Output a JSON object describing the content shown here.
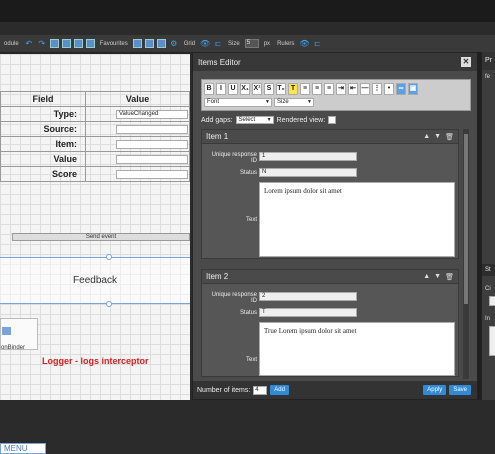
{
  "toolbar": {
    "module_label": "odule",
    "favourites_label": "Favourites",
    "grid_label": "Grid",
    "size_label": "Size",
    "size_value": "5",
    "size_unit": "px",
    "rulers_label": "Rulers"
  },
  "canvas": {
    "table": {
      "header_field": "Field",
      "header_value": "Value",
      "rows": [
        {
          "field": "Type:",
          "value": "ValueChanged"
        },
        {
          "field": "Source:",
          "value": ""
        },
        {
          "field": "Item:",
          "value": ""
        },
        {
          "field": "Value",
          "value": ""
        },
        {
          "field": "Score",
          "value": ""
        }
      ]
    },
    "send_event": "Send event",
    "feedback": "Feedback",
    "binder_label": "onBinder",
    "logger": "Logger - logs interceptor",
    "menu": "MENU"
  },
  "dialog": {
    "title": "Items Editor",
    "rte": {
      "buttons_row1": [
        "B",
        "I",
        "U",
        "X₁",
        "X¹",
        "S",
        "T₀",
        "T"
      ],
      "font_select": "Font",
      "size_select": "Size"
    },
    "add_gaps_label": "Add gaps:",
    "add_gaps_value": "Select",
    "rendered_view_label": "Rendered view:",
    "items": [
      {
        "title": "Item 1",
        "response_id_label": "Unique response ID",
        "response_id": "1",
        "status_label": "Status",
        "status": "N",
        "text_label": "Text",
        "text": "Lorem ipsum dolor sit amet"
      },
      {
        "title": "Item 2",
        "response_id_label": "Unique response ID",
        "response_id": "2",
        "status_label": "Status",
        "status": "T",
        "text_label": "Text",
        "text": "True Lorem ipsum dolor sit amet"
      }
    ],
    "footer": {
      "num_items_label": "Number of items:",
      "num_items_value": "4",
      "add_button": "Add",
      "apply_button": "Apply",
      "save_button": "Save"
    }
  },
  "right_panel": {
    "title": "Pr",
    "line1": "fe",
    "section": "St",
    "c_label": "Ci",
    "i_label": "In"
  },
  "colors": {
    "accent": "#2f8ad8",
    "logger_red": "#d42020"
  }
}
